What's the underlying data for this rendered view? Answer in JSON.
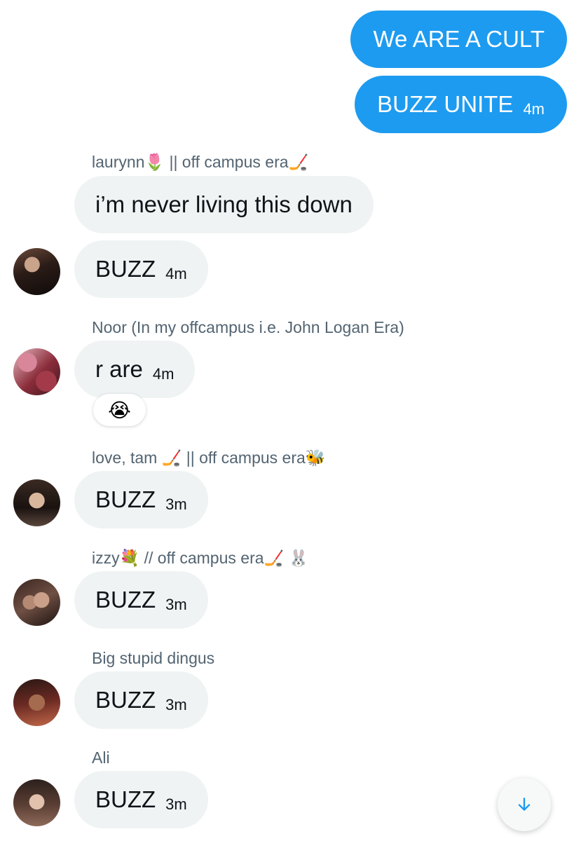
{
  "outgoing": [
    {
      "text": "We ARE A CULT",
      "time": ""
    },
    {
      "text": "BUZZ UNITE",
      "time": "4m"
    }
  ],
  "messages": [
    {
      "sender": "laurynn🌷 || off campus era🏒",
      "text": "i’m never living this down",
      "time": ""
    },
    {
      "sender": "",
      "text": "BUZZ",
      "time": "4m"
    },
    {
      "sender": "Noor (In my offcampus i.e. John Logan Era)",
      "text": "r are",
      "time": "4m",
      "reaction": "😭"
    },
    {
      "sender": "love, tam 🏒 || off campus era🐝",
      "text": "BUZZ",
      "time": "3m"
    },
    {
      "sender": "izzy💐 // off campus era🏒 🐰",
      "text": "BUZZ",
      "time": "3m"
    },
    {
      "sender": "Big stupid dingus",
      "text": "BUZZ",
      "time": "3m"
    },
    {
      "sender": "Ali",
      "text": "BUZZ",
      "time": "3m"
    }
  ],
  "icons": {
    "scroll_down": "arrow-down-icon"
  },
  "colors": {
    "outgoing_bubble": "#1d9bf0",
    "incoming_bubble": "#eff3f4",
    "sender_name": "#536471",
    "accent": "#1d9bf0"
  }
}
